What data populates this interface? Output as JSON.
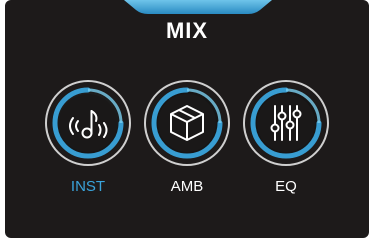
{
  "header": {
    "title": "MIX"
  },
  "modes": [
    {
      "label": "INST",
      "icon": "note-waves-icon",
      "active": true
    },
    {
      "label": "AMB",
      "icon": "cube-icon",
      "active": false
    },
    {
      "label": "EQ",
      "icon": "eq-sliders-icon",
      "active": false
    }
  ],
  "colors": {
    "panel": "#1d1a1a",
    "accent": "#3aa4dc",
    "active_label": "#3aa4dc",
    "label": "#ffffff"
  }
}
